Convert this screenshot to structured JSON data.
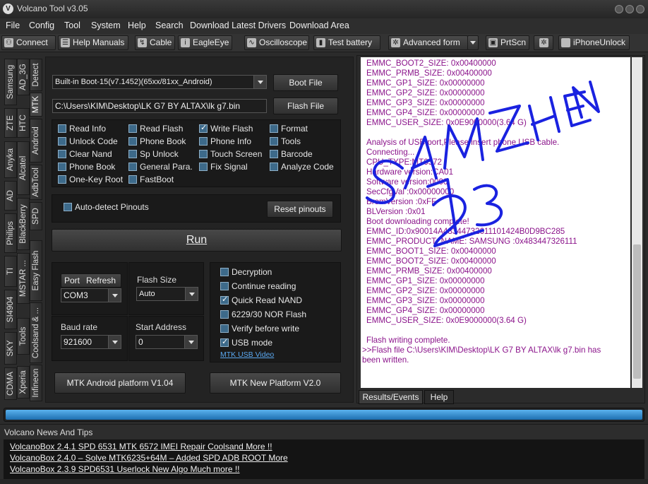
{
  "window": {
    "title": "Volcano Tool v3.05"
  },
  "menu": [
    "File",
    "Config",
    "Tool",
    "System",
    "Help",
    "Search",
    "Download Latest Drivers",
    "Download Area"
  ],
  "toolbar": {
    "connect": "Connect",
    "help_manuals": "Help Manuals",
    "cable": "Cable",
    "eagleeye": "EagleEye",
    "oscilloscope": "Oscilloscope",
    "test_battery": "Test battery",
    "advanced_form": "Advanced form",
    "prtscn": "PrtScn",
    "iphoneunlock": "iPhoneUnlock"
  },
  "side_tabs": {
    "col1": [
      "Samsung",
      "ZTE",
      "Anyka",
      "AD",
      "Philips",
      "TI",
      "SI4904",
      "SKY",
      "CDMA"
    ],
    "col2": [
      "AD_3G",
      "HTC",
      "Alcatel",
      "BlackBerry",
      "MSTAR ...",
      "Tools",
      "Xperia"
    ],
    "col3": [
      "Detect",
      "MTK",
      "Android",
      "AdbTool",
      "SPD",
      "Easy Flash",
      "Coolsand & ...",
      "Infineon"
    ]
  },
  "mtk": {
    "boot_select": "Built-in Boot-15(v7.1452)(65xx/81xx_Android)",
    "boot_file_button": "Boot File",
    "file_path": "C:\\Users\\KIM\\Desktop\\LK G7 BY ALTAX\\lk g7.bin",
    "flash_file_button": "Flash File",
    "options": [
      {
        "label": "Read Info",
        "checked": false
      },
      {
        "label": "Read Flash",
        "checked": false
      },
      {
        "label": "Write Flash",
        "checked": true
      },
      {
        "label": "Format",
        "checked": false
      },
      {
        "label": "Unlock Code",
        "checked": false
      },
      {
        "label": "Phone Book",
        "checked": false
      },
      {
        "label": "Phone Info",
        "checked": false
      },
      {
        "label": "Tools",
        "checked": false
      },
      {
        "label": "Clear Nand",
        "checked": false
      },
      {
        "label": "Sp Unlock",
        "checked": false
      },
      {
        "label": "Touch Screen",
        "checked": false
      },
      {
        "label": "Barcode",
        "checked": false
      },
      {
        "label": "Phone Book",
        "checked": false
      },
      {
        "label": "General Para.",
        "checked": false
      },
      {
        "label": "Fix Signal",
        "checked": false
      },
      {
        "label": "Analyze Code",
        "checked": false
      },
      {
        "label": "One-Key Root",
        "checked": false
      },
      {
        "label": "FastBoot",
        "checked": false
      }
    ],
    "auto_detect": "Auto-detect Pinouts",
    "reset_pinouts": "Reset pinouts",
    "run": "Run",
    "port_label": "Port",
    "refresh_label": "Refresh",
    "port_value": "COM3",
    "flash_size_label": "Flash Size",
    "flash_size_value": "Auto",
    "baud_label": "Baud rate",
    "baud_value": "921600",
    "start_address_label": "Start Address",
    "start_address_value": "0",
    "flags": [
      {
        "label": "Decryption",
        "checked": false
      },
      {
        "label": "Continue reading",
        "checked": false
      },
      {
        "label": "Quick Read NAND",
        "checked": true
      },
      {
        "label": "6229/30 NOR Flash",
        "checked": false
      },
      {
        "label": "Verify before write",
        "checked": false
      },
      {
        "label": "USB mode",
        "checked": true
      }
    ],
    "usb_video_link": "MTK USB Video",
    "android_platform_button": "MTK Android platform V1.04",
    "new_platform_button": "MTK New Platform V2.0"
  },
  "log_lines": [
    "EMMC_BOOT2_SIZE: 0x00400000",
    "EMMC_PRMB_SIZE: 0x00400000",
    "EMMC_GP1_SIZE: 0x00000000",
    "EMMC_GP2_SIZE: 0x00000000",
    "EMMC_GP3_SIZE: 0x00000000",
    "EMMC_GP4_SIZE: 0x00000000",
    "EMMC_USER_SIZE: 0x0E9000000(3.64 G)",
    "",
    "Analysis of USB port,Please insert phone USB cable.",
    "Connecting...",
    "CPU_TYPE:MT6572",
    "Hardware version:CA01",
    "Software version:0000",
    "SecCfgVal :0x00000000",
    "BromVersion :0xFF",
    "BLVersion :0x01",
    "Boot downloading complete!",
    "EMMC_ID:0x90014A48344732611101424B0D9BC285",
    "EMMC_PRODUCT_NAME: SAMSUNG :0x483447326111",
    "EMMC_BOOT1_SIZE: 0x00400000",
    "EMMC_BOOT2_SIZE: 0x00400000",
    "EMMC_PRMB_SIZE: 0x00400000",
    "EMMC_GP1_SIZE: 0x00000000",
    "EMMC_GP2_SIZE: 0x00000000",
    "EMMC_GP3_SIZE: 0x00000000",
    "EMMC_GP4_SIZE: 0x00000000",
    "EMMC_USER_SIZE: 0x0E9000000(3.64 G)",
    "",
    "Flash writing complete.",
    ">>Flash file C:\\Users\\KIM\\Desktop\\LK G7 BY ALTAX\\lk g7.bin has",
    "been written."
  ],
  "result_tabs": {
    "results": "Results/Events",
    "help": "Help"
  },
  "progress": {
    "fraction": 1.0
  },
  "news": {
    "title": "Volcano News And Tips",
    "items": [
      "VolcanoBox 2.4.1 SPD 6531  MTK 6572 IMEI Repair  Coolsand  More !!",
      "VolcanoBox 2.4.0 – Solve MTK6235+64M – Added SPD ADB ROOT  More",
      "VolcanoBox 2.3.9 SPD6531 Userlock New Algo  Much more !!"
    ]
  },
  "watermark": {
    "line1": "SAMZHEN",
    "line2": "123"
  },
  "colors": {
    "log_text": "#8b148b",
    "watermark": "#1a22e0",
    "progress": "#3a8fd6"
  }
}
